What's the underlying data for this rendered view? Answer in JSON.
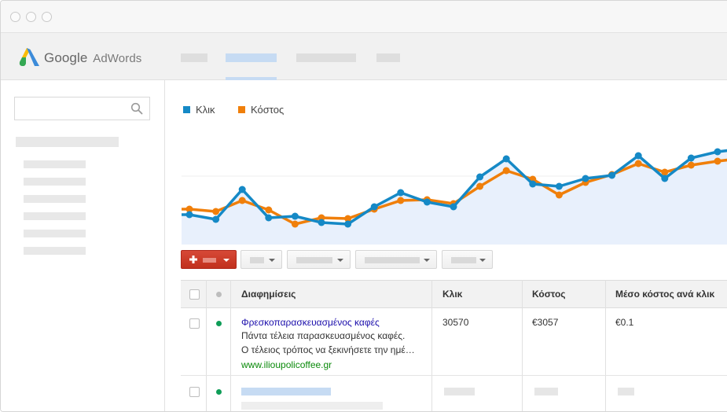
{
  "brand": {
    "google": "Google",
    "product": "AdWords",
    "logo_colors": [
      "#3c8bd9",
      "#fabc09",
      "#34a853"
    ]
  },
  "legend": [
    {
      "label": "Κλικ",
      "color": "#1589c6"
    },
    {
      "label": "Κόστος",
      "color": "#f07f0a"
    }
  ],
  "chart_data": {
    "type": "line",
    "x": [
      1,
      2,
      3,
      4,
      5,
      6,
      7,
      8,
      9,
      10,
      11,
      12,
      13,
      14,
      15,
      16,
      17,
      18,
      19,
      20,
      21,
      22,
      23
    ],
    "series": [
      {
        "name": "Κλικ",
        "color": "#1589c6",
        "area_fill": "#e8f0fc",
        "values": [
          38,
          32,
          70,
          34,
          36,
          28,
          26,
          48,
          66,
          54,
          48,
          86,
          109,
          77,
          74,
          84,
          88,
          113,
          84,
          110,
          118,
          122,
          125
        ]
      },
      {
        "name": "Κόστος",
        "color": "#f07f0a",
        "values": [
          45,
          42,
          56,
          44,
          26,
          34,
          33,
          45,
          56,
          57,
          52,
          74,
          94,
          83,
          63,
          79,
          89,
          103,
          92,
          101,
          106,
          110,
          114
        ]
      }
    ],
    "ylim": [
      0,
      160
    ],
    "grid": false
  },
  "table": {
    "headers": [
      "Διαφημίσεις",
      "Κλικ",
      "Κόστος",
      "Μέσο κόστος ανά κλικ"
    ],
    "status_color": "#0f9d58",
    "rows": [
      {
        "ad_title": "Φρεσκοπαρασκευασμένος καφές",
        "ad_line1": "Πάντα τέλεια παρασκευασμένος καφές.",
        "ad_line2": "Ο τέλειος τρόπος να ξεκινήσετε την ημέ…",
        "ad_url": "www.ilioupolicoffee.gr",
        "clicks": "30570",
        "cost": "€3057",
        "avg_cpc": "€0.1"
      }
    ]
  }
}
